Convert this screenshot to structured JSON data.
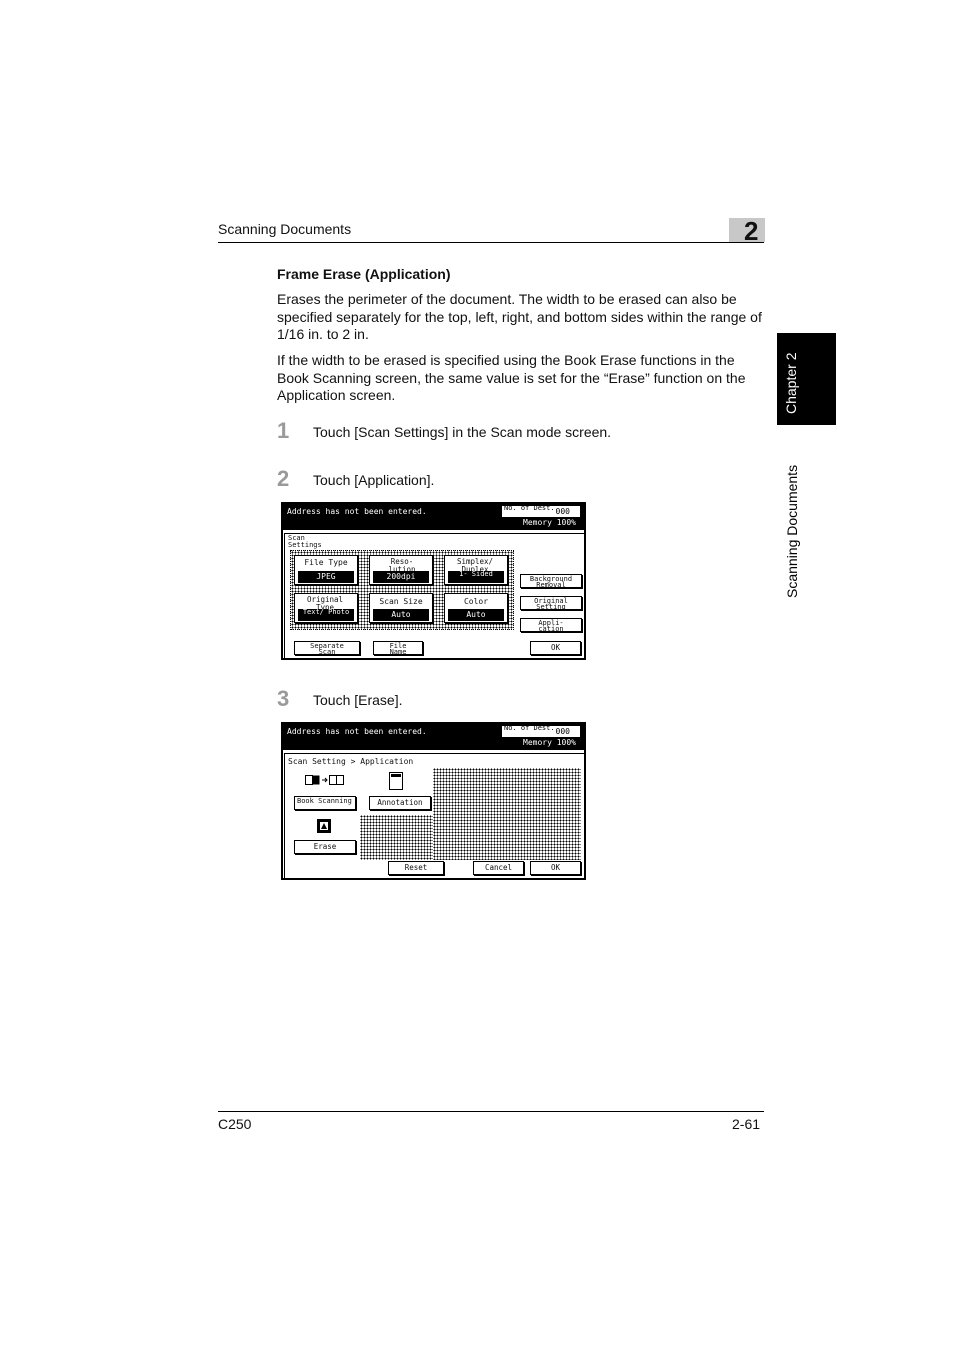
{
  "header": {
    "title": "Scanning Documents",
    "chapter_number": "2"
  },
  "side_tab": {
    "chapter": "Chapter 2",
    "section": "Scanning Documents"
  },
  "section": {
    "heading": "Frame Erase (Application)",
    "para1": "Erases the perimeter of the document. The width to be erased can also be specified separately for the top, left, right, and bottom sides within the range of 1/16 in. to 2 in.",
    "para2": "If the width to be erased is specified using the Book Erase functions in the Book Scanning screen, the same value is set for the “Erase” function on the Application screen."
  },
  "steps": [
    {
      "num": "1",
      "text": "Touch [Scan Settings] in the Scan mode screen."
    },
    {
      "num": "2",
      "text": "Touch [Application]."
    },
    {
      "num": "3",
      "text": "Touch [Erase]."
    }
  ],
  "screen1": {
    "message": "Address has not been entered.",
    "dest_label": "No. of Dest.",
    "dest_value": "000",
    "memory": "Memory 100%",
    "title": "Scan Settings",
    "file_type": {
      "label": "File Type",
      "value": "JPEG"
    },
    "resolution": {
      "label": "Reso- lution",
      "value": "200dpi"
    },
    "simplex": {
      "label": "Simplex/ Duplex",
      "value": "1- Sided"
    },
    "original_type": {
      "label": "Original Type",
      "value": "Text/ Photo"
    },
    "scan_size": {
      "label": "Scan Size",
      "value": "Auto"
    },
    "color": {
      "label": "Color",
      "value": "Auto"
    },
    "background_removal": "Background Removal",
    "original_setting": "Original Setting",
    "application": "Appli- cation",
    "separate_scan": "Separate Scan",
    "file_name": "File Name",
    "ok": "OK"
  },
  "screen2": {
    "message": "Address has not been entered.",
    "dest_label": "No. of Dest.",
    "dest_value": "000",
    "memory": "Memory 100%",
    "breadcrumb": "Scan Setting > Application",
    "book_scanning": "Book Scanning",
    "annotation": "Annotation",
    "erase": "Erase",
    "reset": "Reset",
    "cancel": "Cancel",
    "ok": "OK"
  },
  "footer": {
    "model": "C250",
    "page": "2-61"
  }
}
